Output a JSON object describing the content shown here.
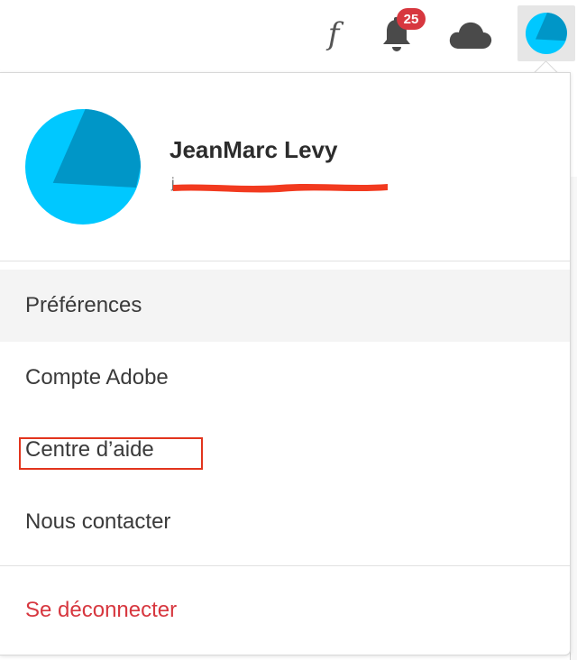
{
  "topbar": {
    "font_glyph": "f",
    "notifications_count": "25",
    "icons": [
      "fonts-icon",
      "bell-icon",
      "cloud-icon",
      "avatar-icon"
    ]
  },
  "profile": {
    "name": "JeanMarc Levy",
    "email": "j",
    "email_redacted": true
  },
  "menu": {
    "preferences": "Préférences",
    "adobe_account": "Compte Adobe",
    "help_center": "Centre d’aide",
    "contact_us": "Nous contacter",
    "sign_out": "Se déconnecter"
  },
  "colors": {
    "avatar_light": "#00c8ff",
    "avatar_dark": "#0096c7",
    "badge": "#d7373f",
    "sign_out": "#d7373f",
    "annotation_box": "#e2341d",
    "redaction": "#f23a1f"
  }
}
